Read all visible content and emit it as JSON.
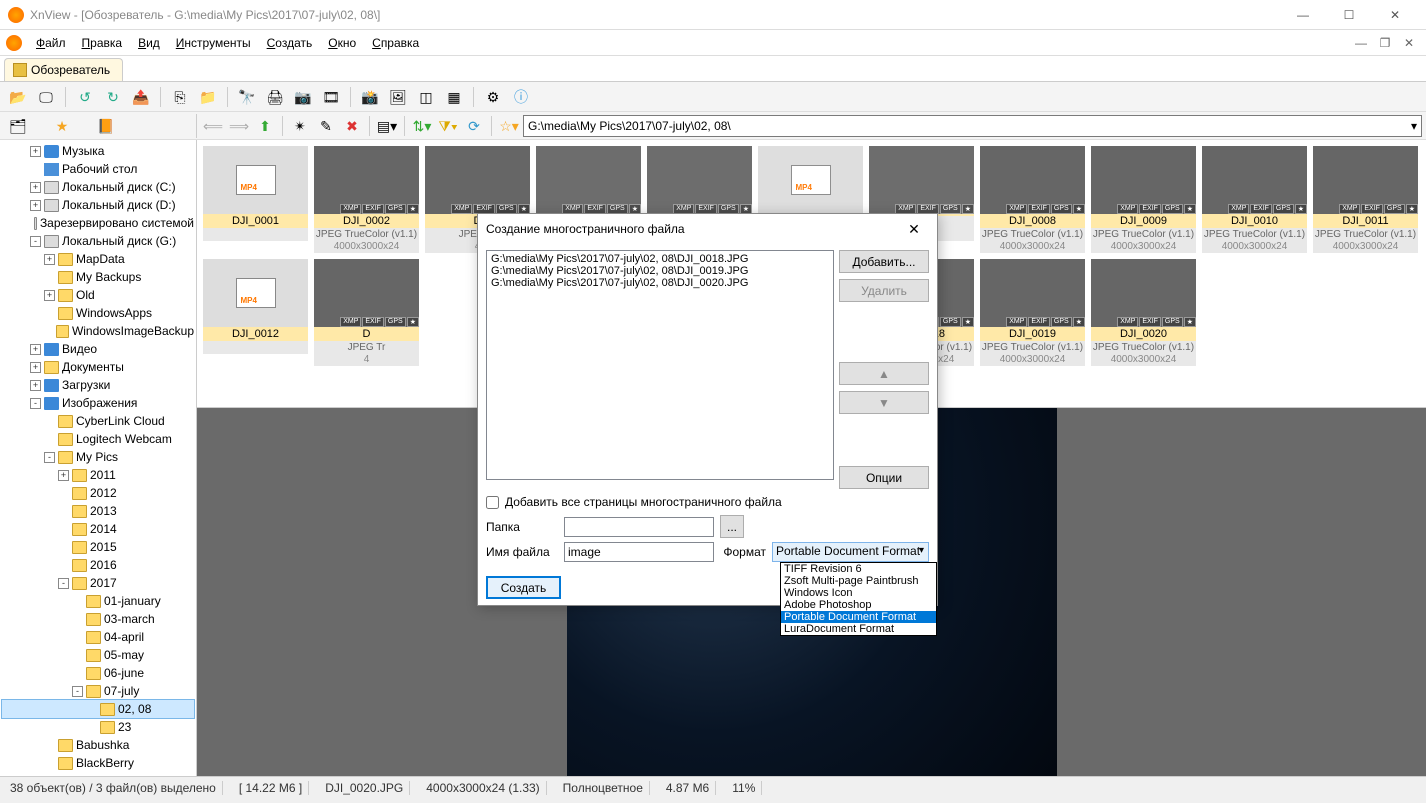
{
  "window": {
    "title": "XnView - [Обозреватель - G:\\media\\My Pics\\2017\\07-july\\02, 08\\]"
  },
  "menu": [
    "Файл",
    "Правка",
    "Вид",
    "Инструменты",
    "Создать",
    "Окно",
    "Справка"
  ],
  "tab": "Обозреватель",
  "path": "G:\\media\\My Pics\\2017\\07-july\\02, 08\\",
  "tree": [
    {
      "lvl": 2,
      "exp": "+",
      "label": "Музыка",
      "icon": "music-i"
    },
    {
      "lvl": 2,
      "exp": "",
      "label": "Рабочий стол",
      "icon": "desk-i"
    },
    {
      "lvl": 2,
      "exp": "+",
      "label": "Локальный диск (C:)",
      "icon": "drive"
    },
    {
      "lvl": 2,
      "exp": "+",
      "label": "Локальный диск (D:)",
      "icon": "drive"
    },
    {
      "lvl": 2,
      "exp": "",
      "label": "Зарезервировано системой",
      "icon": "drive"
    },
    {
      "lvl": 2,
      "exp": "-",
      "label": "Локальный диск (G:)",
      "icon": "drive"
    },
    {
      "lvl": 3,
      "exp": "+",
      "label": "MapData",
      "icon": "folder"
    },
    {
      "lvl": 3,
      "exp": "",
      "label": "My Backups",
      "icon": "folder"
    },
    {
      "lvl": 3,
      "exp": "+",
      "label": "Old",
      "icon": "folder"
    },
    {
      "lvl": 3,
      "exp": "",
      "label": "WindowsApps",
      "icon": "folder"
    },
    {
      "lvl": 3,
      "exp": "",
      "label": "WindowsImageBackup",
      "icon": "folder"
    },
    {
      "lvl": 2,
      "exp": "+",
      "label": "Видео",
      "icon": "arrow-i"
    },
    {
      "lvl": 2,
      "exp": "+",
      "label": "Документы",
      "icon": "folder"
    },
    {
      "lvl": 2,
      "exp": "+",
      "label": "Загрузки",
      "icon": "arrow-i"
    },
    {
      "lvl": 2,
      "exp": "-",
      "label": "Изображения",
      "icon": "arrow-i"
    },
    {
      "lvl": 3,
      "exp": "",
      "label": "CyberLink Cloud",
      "icon": "folder"
    },
    {
      "lvl": 3,
      "exp": "",
      "label": "Logitech Webcam",
      "icon": "folder"
    },
    {
      "lvl": 3,
      "exp": "-",
      "label": "My Pics",
      "icon": "folder"
    },
    {
      "lvl": 4,
      "exp": "+",
      "label": "2011",
      "icon": "folder"
    },
    {
      "lvl": 4,
      "exp": "",
      "label": "2012",
      "icon": "folder"
    },
    {
      "lvl": 4,
      "exp": "",
      "label": "2013",
      "icon": "folder"
    },
    {
      "lvl": 4,
      "exp": "",
      "label": "2014",
      "icon": "folder"
    },
    {
      "lvl": 4,
      "exp": "",
      "label": "2015",
      "icon": "folder"
    },
    {
      "lvl": 4,
      "exp": "",
      "label": "2016",
      "icon": "folder"
    },
    {
      "lvl": 4,
      "exp": "-",
      "label": "2017",
      "icon": "folder"
    },
    {
      "lvl": 5,
      "exp": "",
      "label": "01-january",
      "icon": "folder"
    },
    {
      "lvl": 5,
      "exp": "",
      "label": "03-march",
      "icon": "folder"
    },
    {
      "lvl": 5,
      "exp": "",
      "label": "04-april",
      "icon": "folder"
    },
    {
      "lvl": 5,
      "exp": "",
      "label": "05-may",
      "icon": "folder"
    },
    {
      "lvl": 5,
      "exp": "",
      "label": "06-june",
      "icon": "folder"
    },
    {
      "lvl": 5,
      "exp": "-",
      "label": "07-july",
      "icon": "folder"
    },
    {
      "lvl": 6,
      "exp": "",
      "label": "02, 08",
      "icon": "folder",
      "sel": true
    },
    {
      "lvl": 6,
      "exp": "",
      "label": "23",
      "icon": "folder"
    },
    {
      "lvl": 3,
      "exp": "",
      "label": "Babushka",
      "icon": "folder"
    },
    {
      "lvl": 3,
      "exp": "",
      "label": "BlackBerry",
      "icon": "folder"
    }
  ],
  "thumbs": [
    {
      "name": "DJI_0001",
      "video": true
    },
    {
      "name": "DJI_0002",
      "meta1": "JPEG TrueColor (v1.1)",
      "meta2": "4000x3000x24",
      "cls": "ph-green",
      "badges": true
    },
    {
      "name": "D",
      "meta1": "JPEG Tr",
      "meta2": "4",
      "cls": "ph-green",
      "badges": true
    },
    {
      "name": "",
      "cls": "ph-green",
      "badges": true,
      "half": true
    },
    {
      "name": "",
      "cls": "ph-green",
      "badges": true,
      "half": true
    },
    {
      "name": "",
      "video": true,
      "half": true
    },
    {
      "name": "",
      "cls": "ph-green",
      "badges": true,
      "half": true
    },
    {
      "name": "DJI_0008",
      "meta1": "JPEG TrueColor (v1.1)",
      "meta2": "4000x3000x24",
      "cls": "ph-green",
      "badges": true
    },
    {
      "name": "DJI_0009",
      "meta1": "JPEG TrueColor (v1.1)",
      "meta2": "4000x3000x24",
      "cls": "ph-green",
      "badges": true
    },
    {
      "name": "DJI_0010",
      "meta1": "JPEG TrueColor (v1.1)",
      "meta2": "4000x3000x24",
      "cls": "ph-green",
      "badges": true
    },
    {
      "name": "DJI_0011",
      "meta1": "JPEG TrueColor (v1.1)",
      "meta2": "4000x3000x24",
      "cls": "ph-night",
      "badges": true
    },
    {
      "name": "DJI_0012",
      "video": true
    },
    {
      "name": "D",
      "meta1": "JPEG Tr",
      "meta2": "4",
      "cls": "ph-night",
      "badges": true
    },
    {
      "name": "",
      "hidden": true
    },
    {
      "name": "",
      "hidden": true
    },
    {
      "name": "",
      "hidden": true
    },
    {
      "name": "",
      "cls": "ph-night",
      "badges": true,
      "half": true
    },
    {
      "name": "DJI_0018",
      "meta1": "JPEG TrueColor (v1.1)",
      "meta2": "4000x3000x24",
      "cls": "ph-night",
      "badges": true
    },
    {
      "name": "DJI_0019",
      "meta1": "JPEG TrueColor (v1.1)",
      "meta2": "4000x3000x24",
      "cls": "ph-night",
      "badges": true
    },
    {
      "name": "DJI_0020",
      "meta1": "JPEG TrueColor (v1.1)",
      "meta2": "4000x3000x24",
      "cls": "ph-night",
      "badges": true
    }
  ],
  "badges": [
    "XMP",
    "EXIF",
    "GPS"
  ],
  "status": {
    "count": "38 объект(ов) / 3 файл(ов) выделено",
    "size1": "[ 14.22 М6 ]",
    "file": "DJI_0020.JPG",
    "dims": "4000x3000x24 (1.33)",
    "color": "Полноцветное",
    "size2": "4.87 М6",
    "zoom": "11%"
  },
  "dialog": {
    "title": "Создание многостраничного файла",
    "files": [
      "G:\\media\\My Pics\\2017\\07-july\\02, 08\\DJI_0018.JPG",
      "G:\\media\\My Pics\\2017\\07-july\\02, 08\\DJI_0019.JPG",
      "G:\\media\\My Pics\\2017\\07-july\\02, 08\\DJI_0020.JPG"
    ],
    "add_btn": "Добавить...",
    "del_btn": "Удалить",
    "opt_btn": "Опции",
    "checkbox": "Добавить все страницы многостраничного файла",
    "folder_lbl": "Папка",
    "folder_val": "",
    "browse": "...",
    "name_lbl": "Имя файла",
    "name_val": "image",
    "format_lbl": "Формат",
    "format_val": "Portable Document Format",
    "formats": [
      "TIFF Revision 6",
      "Zsoft Multi-page Paintbrush",
      "Windows Icon",
      "Adobe Photoshop",
      "Portable Document Format",
      "LuraDocument Format"
    ],
    "create_btn": "Создать"
  }
}
